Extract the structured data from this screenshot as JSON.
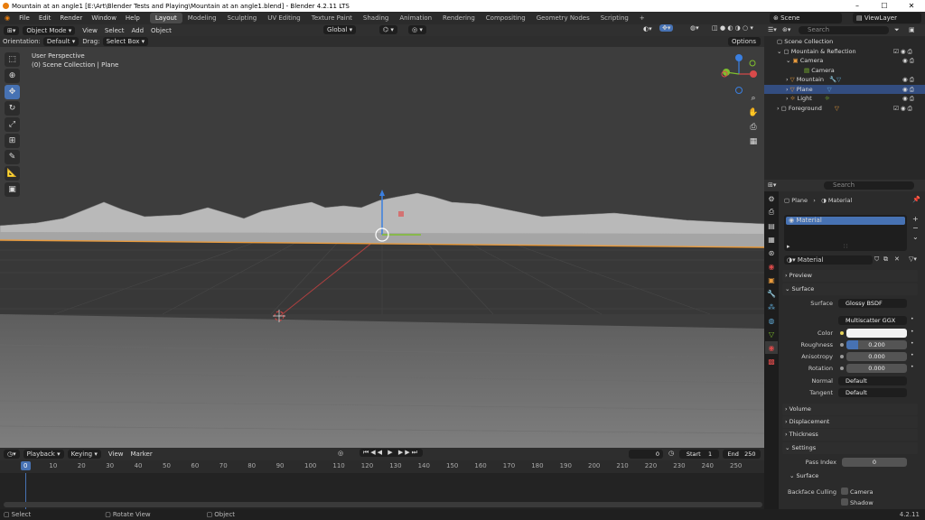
{
  "window": {
    "title": "Mountain at an angle1 [E:\\Art\\Blender Tests and Playing\\Mountain at an angle1.blend] - Blender 4.2.11 LTS"
  },
  "menus": [
    "File",
    "Edit",
    "Render",
    "Window",
    "Help"
  ],
  "workspaces": [
    "Layout",
    "Modeling",
    "Sculpting",
    "UV Editing",
    "Texture Paint",
    "Shading",
    "Animation",
    "Rendering",
    "Compositing",
    "Geometry Nodes",
    "Scripting"
  ],
  "active_workspace": "Layout",
  "scene_name": "Scene",
  "view_layer": "ViewLayer",
  "viewport_header": {
    "mode": "Object Mode",
    "menus": [
      "View",
      "Select",
      "Add",
      "Object"
    ],
    "transform_orientation": "Global"
  },
  "tool_settings": {
    "orientation_label": "Orientation:",
    "orientation_value": "Default",
    "drag_label": "Drag:",
    "drag_value": "Select Box",
    "options_label": "Options"
  },
  "viewport": {
    "view_name": "User Perspective",
    "collection_info": "(0) Scene Collection | Plane"
  },
  "outliner": {
    "search_placeholder": "Search",
    "rows": [
      {
        "label": "Scene Collection"
      },
      {
        "label": "Mountain & Reflection"
      },
      {
        "label": "Camera"
      },
      {
        "label": "Camera"
      },
      {
        "label": "Mountain"
      },
      {
        "label": "Plane"
      },
      {
        "label": "Light"
      },
      {
        "label": "Foreground"
      }
    ]
  },
  "properties": {
    "search_placeholder": "Search",
    "breadcrumb_object": "Plane",
    "breadcrumb_material": "Material",
    "slot_name": "Material",
    "material_name": "Material",
    "panels": {
      "preview": "Preview",
      "surface": "Surface",
      "volume": "Volume",
      "displacement": "Displacement",
      "thickness": "Thickness",
      "settings": "Settings",
      "settings_surface": "Surface"
    },
    "surface_label": "Surface",
    "surface_value": "Glossy BSDF",
    "distribution": "Multiscatter GGX",
    "color_label": "Color",
    "color_value": "#f2f2f2",
    "roughness_label": "Roughness",
    "roughness_value": "0.200",
    "anisotropy_label": "Anisotropy",
    "anisotropy_value": "0.000",
    "rotation_label": "Rotation",
    "rotation_value": "0.000",
    "normal_label": "Normal",
    "normal_value": "Default",
    "tangent_label": "Tangent",
    "tangent_value": "Default",
    "pass_index_label": "Pass Index",
    "pass_index_value": "0",
    "backface_label": "Backface Culling",
    "backface_camera": "Camera",
    "backface_shadow": "Shadow"
  },
  "timeline": {
    "menus": [
      "Playback",
      "Keying",
      "View",
      "Marker"
    ],
    "current_frame": "0",
    "start_label": "Start",
    "start_value": "1",
    "end_label": "End",
    "end_value": "250",
    "ruler": [
      "0",
      "10",
      "20",
      "30",
      "40",
      "50",
      "60",
      "70",
      "80",
      "90",
      "100",
      "110",
      "120",
      "130",
      "140",
      "150",
      "160",
      "170",
      "180",
      "190",
      "200",
      "210",
      "220",
      "230",
      "240",
      "250"
    ]
  },
  "status_bar": {
    "select": "Select",
    "rotate": "Rotate View",
    "object": "Object",
    "version": "4.2.11"
  },
  "colors": {
    "accent": "#4772b3",
    "selection_outline": "#e89a3c",
    "axis_x": "#d94a4a",
    "axis_y": "#7fbf2e",
    "axis_z": "#3a7fe0"
  }
}
